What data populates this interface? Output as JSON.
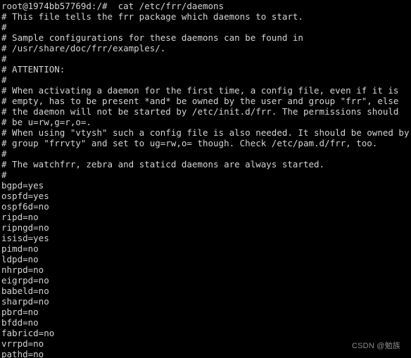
{
  "terminal": {
    "background_color": "#000000",
    "foreground_color": "#d4d4d4",
    "prompt": {
      "user": "root",
      "host": "1974bb57769d",
      "cwd": "/",
      "symbol": "#",
      "full": "root@1974bb57769d:/#",
      "command": "cat /etc/frr/daemons",
      "full_line": "root@1974bb57769d:/#  cat /etc/frr/daemons"
    },
    "output_lines": [
      "# This file tells the frr package which daemons to start.",
      "#",
      "# Sample configurations for these daemons can be found in",
      "# /usr/share/doc/frr/examples/.",
      "#",
      "# ATTENTION:",
      "#",
      "# When activating a daemon for the first time, a config file, even if it is",
      "# empty, has to be present *and* be owned by the user and group \"frr\", else",
      "# the daemon will not be started by /etc/init.d/frr. The permissions should",
      "# be u=rw,g=r,o=.",
      "# When using \"vtysh\" such a config file is also needed. It should be owned by",
      "# group \"frrvty\" and set to ug=rw,o= though. Check /etc/pam.d/frr, too.",
      "#",
      "# The watchfrr, zebra and staticd daemons are always started.",
      "#",
      "bgpd=yes",
      "ospfd=yes",
      "ospf6d=no",
      "ripd=no",
      "ripngd=no",
      "isisd=yes",
      "pimd=no",
      "ldpd=no",
      "nhrpd=no",
      "eigrpd=no",
      "babeld=no",
      "sharpd=no",
      "pbrd=no",
      "bfdd=no",
      "fabricd=no",
      "vrrpd=no",
      "pathd=no"
    ],
    "daemon_settings": [
      {
        "name": "bgpd",
        "value": "yes"
      },
      {
        "name": "ospfd",
        "value": "yes"
      },
      {
        "name": "ospf6d",
        "value": "no"
      },
      {
        "name": "ripd",
        "value": "no"
      },
      {
        "name": "ripngd",
        "value": "no"
      },
      {
        "name": "isisd",
        "value": "yes"
      },
      {
        "name": "pimd",
        "value": "no"
      },
      {
        "name": "ldpd",
        "value": "no"
      },
      {
        "name": "nhrpd",
        "value": "no"
      },
      {
        "name": "eigrpd",
        "value": "no"
      },
      {
        "name": "babeld",
        "value": "no"
      },
      {
        "name": "sharpd",
        "value": "no"
      },
      {
        "name": "pbrd",
        "value": "no"
      },
      {
        "name": "bfdd",
        "value": "no"
      },
      {
        "name": "fabricd",
        "value": "no"
      },
      {
        "name": "vrrpd",
        "value": "no"
      },
      {
        "name": "pathd",
        "value": "no"
      }
    ]
  },
  "watermark": {
    "text": "CSDN @勉族",
    "color": "#8c8c8c"
  }
}
